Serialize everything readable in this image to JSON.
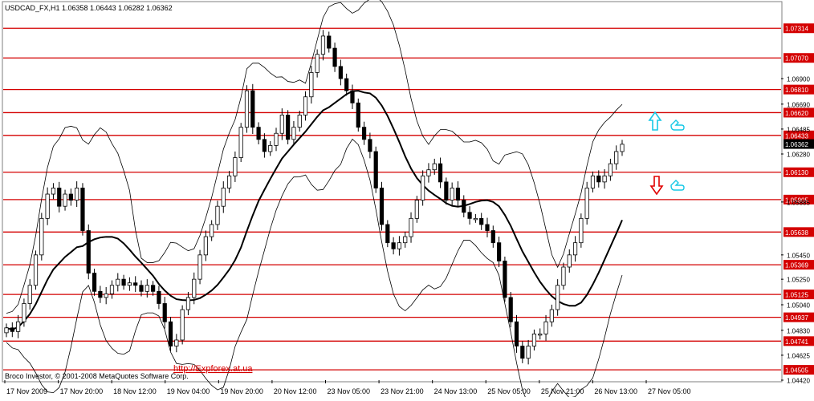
{
  "header": {
    "title": "USDCAD_FX,H1 1.06358 1.06443 1.06282 1.06362"
  },
  "footer": {
    "copyright": "Broco Investor, © 2001-2008 MetaQuotes Software Corp.",
    "link": "http://Expforex.at.ua"
  },
  "colors": {
    "background": "#ffffff",
    "grid": "#c0c0c0",
    "level": "#d40000",
    "candle": "#000000",
    "up_arrow": "#17c8e6",
    "down_arrow": "#e00000",
    "hand": "#17c8e6",
    "ma": "#000000",
    "band": "#000000",
    "link": "#d40000"
  },
  "icons": {
    "buy_signal": "up-arrow-icon",
    "sell_signal": "down-arrow-icon",
    "pointer": "hand-pointer-icon"
  },
  "chart_data": {
    "type": "candlestick",
    "symbol": "USDCAD_FX",
    "timeframe": "H1",
    "ohlc_current": {
      "open": 1.06358,
      "high": 1.06443,
      "low": 1.06282,
      "close": 1.06362
    },
    "ylim": [
      1.0442,
      1.0752
    ],
    "x_labels": [
      "17 Nov 2009",
      "17 Nov 20:00",
      "18 Nov 12:00",
      "19 Nov 04:00",
      "19 Nov 20:00",
      "20 Nov 12:00",
      "23 Nov 05:00",
      "23 Nov 21:00",
      "24 Nov 13:00",
      "25 Nov 05:00",
      "25 Nov 21:00",
      "26 Nov 13:00",
      "27 Nov 05:00"
    ],
    "y_tick_labels": [
      "1.06900",
      "1.06690",
      "1.06485",
      "1.06280",
      "1.05885",
      "1.05450",
      "1.05250",
      "1.05040",
      "1.04830",
      "1.04625",
      "1.04420"
    ],
    "levels": [
      "1.07314",
      "1.07070",
      "1.06810",
      "1.06620",
      "1.06433",
      "1.06130",
      "1.05905",
      "1.05638",
      "1.05369",
      "1.05125",
      "1.04937",
      "1.04741",
      "1.04505"
    ],
    "current_price": "1.06362",
    "close_series": [
      1.0485,
      1.0482,
      1.049,
      1.0505,
      1.052,
      1.0545,
      1.0575,
      1.0595,
      1.06,
      1.0585,
      1.0595,
      1.059,
      1.06,
      1.0565,
      1.053,
      1.0515,
      1.051,
      1.0513,
      1.052,
      1.0525,
      1.052,
      1.0522,
      1.052,
      1.0515,
      1.052,
      1.0515,
      1.0505,
      1.049,
      1.047,
      1.0475,
      1.05,
      1.051,
      1.0525,
      1.0545,
      1.056,
      1.057,
      1.0585,
      1.06,
      1.061,
      1.0625,
      1.065,
      1.068,
      1.065,
      1.064,
      1.063,
      1.0635,
      1.0645,
      1.066,
      1.064,
      1.065,
      1.066,
      1.0675,
      1.0695,
      1.071,
      1.0725,
      1.0715,
      1.07,
      1.069,
      1.068,
      1.067,
      1.065,
      1.064,
      1.063,
      1.06,
      1.057,
      1.0555,
      1.055,
      1.0555,
      1.056,
      1.0575,
      1.059,
      1.061,
      1.0615,
      1.062,
      1.0605,
      1.059,
      1.06,
      1.059,
      1.058,
      1.0575,
      1.0575,
      1.057,
      1.0565,
      1.0555,
      1.054,
      1.051,
      1.049,
      1.047,
      1.046,
      1.047,
      1.048,
      1.048,
      1.049,
      1.05,
      1.052,
      1.0535,
      1.0545,
      1.0555,
      1.0575,
      1.06,
      1.061,
      1.0605,
      1.061,
      1.062,
      1.063,
      1.0636
    ],
    "indicators": [
      "Moving Average",
      "Bollinger Bands"
    ]
  }
}
